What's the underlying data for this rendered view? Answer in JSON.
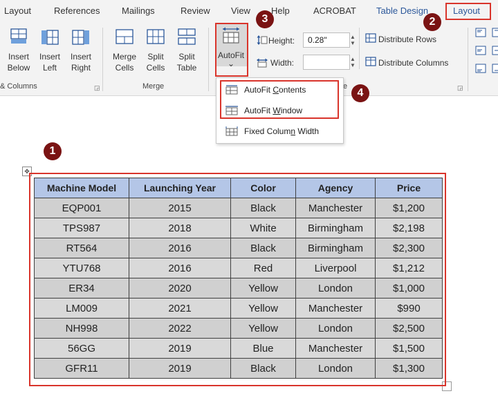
{
  "tabs": [
    "Layout",
    "References",
    "Mailings",
    "Review",
    "View",
    "Help",
    "ACROBAT",
    "Table Design",
    "Layout"
  ],
  "ribbon": {
    "rows_columns": {
      "insert_below": [
        "Insert",
        "Below"
      ],
      "insert_left": [
        "Insert",
        "Left"
      ],
      "insert_right": [
        "Insert",
        "Right"
      ],
      "group_label": "& Columns"
    },
    "merge": {
      "merge_cells": [
        "Merge",
        "Cells"
      ],
      "split_cells": [
        "Split",
        "Cells"
      ],
      "split_table": [
        "Split",
        "Table"
      ],
      "group_label": "Merge"
    },
    "autofit": {
      "label": "AutoFit",
      "caret": "⌄"
    },
    "cell_size": {
      "height_label": "Height:",
      "height_value": "0.28\"",
      "width_label": "Width:",
      "width_value": "",
      "distribute_rows": "Distribute Rows",
      "distribute_columns": "Distribute Columns",
      "group_label_fragment": "e"
    }
  },
  "autofit_menu": {
    "items": [
      {
        "pre": "AutoFit ",
        "key": "C",
        "post": "ontents"
      },
      {
        "pre": "AutoFit ",
        "key": "W",
        "post": "indow"
      },
      {
        "pre": "Fixed Colum",
        "key": "n",
        "post": " Width"
      }
    ]
  },
  "callouts": [
    "1",
    "2",
    "3",
    "4"
  ],
  "colors": {
    "callout_bg": "#7a1313",
    "highlight": "#d9342b",
    "header_fill": "#b4c6e7",
    "cell_fill": "#d0d0d0",
    "accent": "#2b579a"
  },
  "table": {
    "headers": [
      "Machine Model",
      "Launching Year",
      "Color",
      "Agency",
      "Price"
    ],
    "rows": [
      [
        "EQP001",
        "2015",
        "Black",
        "Manchester",
        "$1,200"
      ],
      [
        "TPS987",
        "2018",
        "White",
        "Birmingham",
        "$2,198"
      ],
      [
        "RT564",
        "2016",
        "Black",
        "Birmingham",
        "$2,300"
      ],
      [
        "YTU768",
        "2016",
        "Red",
        "Liverpool",
        "$1,212"
      ],
      [
        "ER34",
        "2020",
        "Yellow",
        "London",
        "$1,000"
      ],
      [
        "LM009",
        "2021",
        "Yellow",
        "Manchester",
        "$990"
      ],
      [
        "NH998",
        "2022",
        "Yellow",
        "London",
        "$2,500"
      ],
      [
        "56GG",
        "2019",
        "Blue",
        "Manchester",
        "$1,500"
      ],
      [
        "GFR11",
        "2019",
        "Black",
        "London",
        "$1,300"
      ]
    ]
  }
}
